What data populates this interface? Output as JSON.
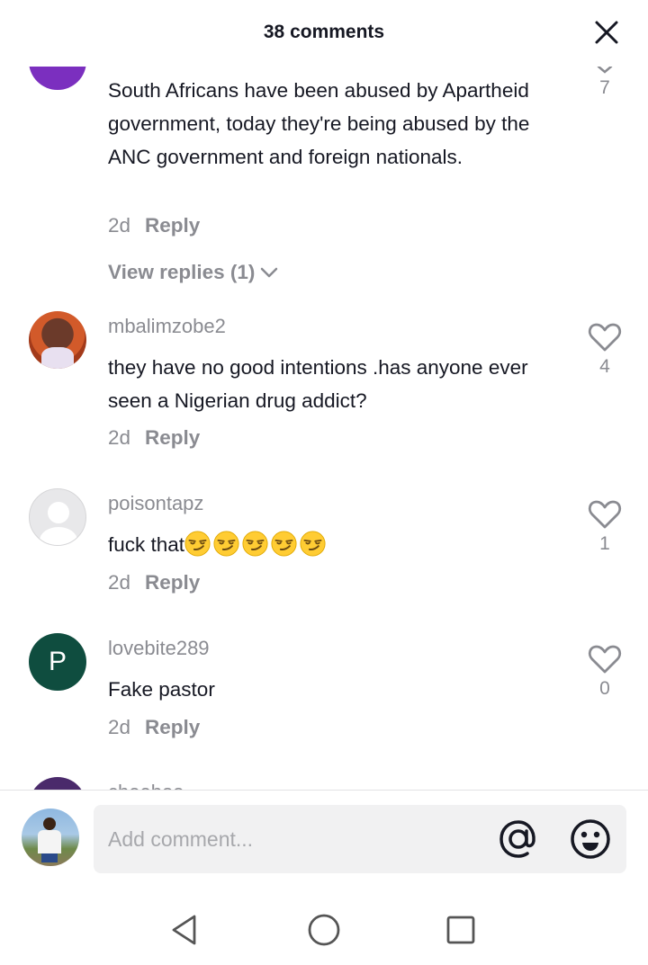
{
  "header": {
    "title": "38 comments",
    "close_icon": "close-icon"
  },
  "comments": [
    {
      "text": "South Africans have been abused by Apartheid government, today they're being abused by the ANC government and foreign nationals.",
      "time": "2d",
      "reply_label": "Reply",
      "likes": "7",
      "view_replies": "View replies (1)",
      "avatar_color": "#7b2fbf"
    },
    {
      "username": "mbalimzobe2",
      "text": "they have no good intentions .has anyone ever seen a Nigerian drug addict?",
      "time": "2d",
      "reply_label": "Reply",
      "likes": "4"
    },
    {
      "username": "poisontapz",
      "text": "fuck that",
      "emojis": [
        "smirk-emoji",
        "smirk-emoji",
        "smirk-emoji",
        "smirk-emoji",
        "smirk-emoji"
      ],
      "time": "2d",
      "reply_label": "Reply",
      "likes": "1"
    },
    {
      "username": "lovebite289",
      "avatar_letter": "P",
      "avatar_color": "#0f4d3f",
      "text": "Fake pastor",
      "time": "2d",
      "reply_label": "Reply",
      "likes": "0"
    },
    {
      "username": "cheeboo",
      "avatar_color": "#4a2a6b"
    }
  ],
  "compose": {
    "placeholder": "Add comment...",
    "mention_icon": "at-sign-icon",
    "emoji_icon": "smiley-icon"
  },
  "navbar": {
    "back_icon": "back-triangle-icon",
    "home_icon": "home-circle-icon",
    "recents_icon": "recents-square-icon"
  },
  "colors": {
    "text": "#161823",
    "secondary": "#8a8b91",
    "input_bg": "#f1f1f2"
  }
}
